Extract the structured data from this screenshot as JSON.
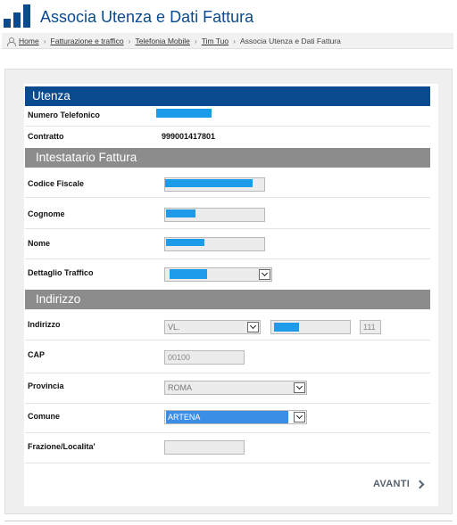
{
  "header": {
    "title": "Associa Utenza e Dati Fattura"
  },
  "breadcrumb": {
    "items": [
      "Home",
      "Fatturazione e traffico",
      "Telefonia Mobile",
      "Tim Tuo"
    ],
    "current": "Associa Utenza e Dati Fattura",
    "separator": "›"
  },
  "utenza": {
    "title": "Utenza",
    "numero_label": "Numero Telefonico",
    "contratto_label": "Contratto",
    "contratto_value": "999001417801"
  },
  "intestatario": {
    "title": "Intestatario Fattura",
    "codice_fiscale_label": "Codice Fiscale",
    "cognome_label": "Cognome",
    "nome_label": "Nome",
    "dettaglio_label": "Dettaglio Traffico"
  },
  "indirizzo": {
    "title": "Indirizzo",
    "indirizzo_label": "Indirizzo",
    "tipo_via_value": "VL.",
    "civico_value": "111",
    "cap_label": "CAP",
    "cap_value": "00100",
    "provincia_label": "Provincia",
    "provincia_value": "ROMA",
    "comune_label": "Comune",
    "comune_value": "ARTENA",
    "frazione_label": "Frazione/Localita'"
  },
  "actions": {
    "avanti_label": "AVANTI"
  },
  "colors": {
    "brand_blue": "#0a4a8f",
    "section_gray": "#8c8c8c",
    "redaction": "#1e9be8"
  }
}
